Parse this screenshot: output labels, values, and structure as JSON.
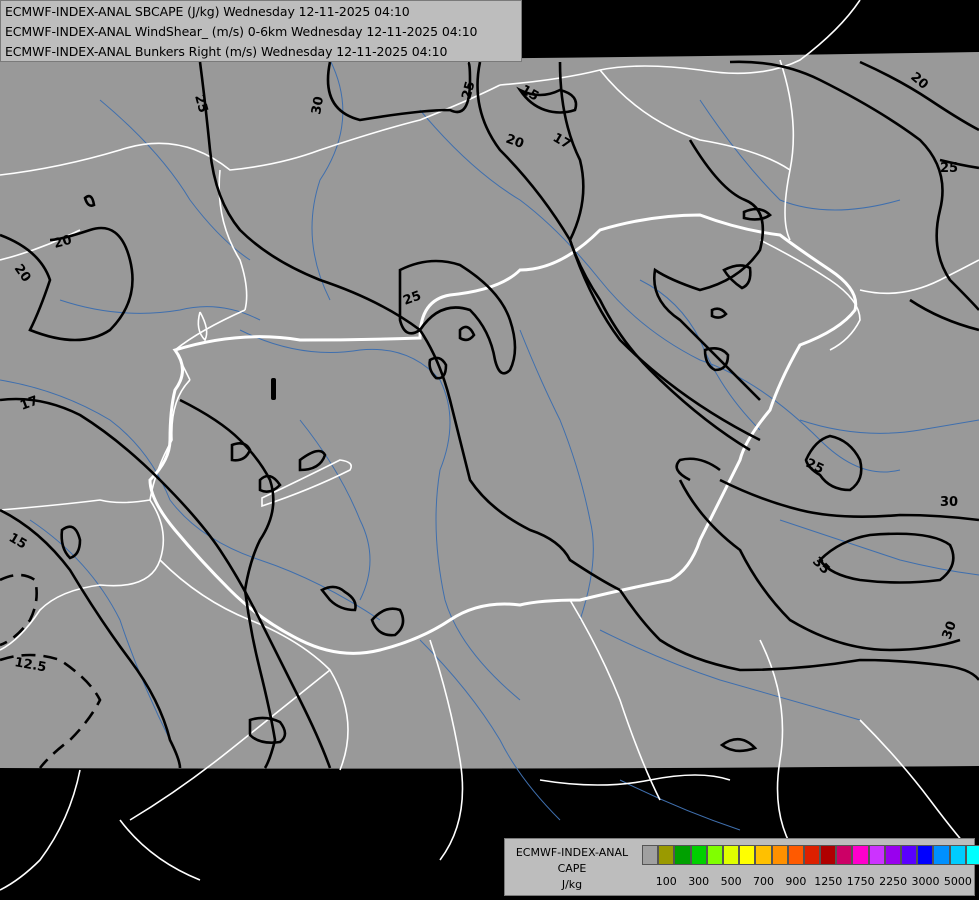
{
  "header": {
    "line1": "ECMWF-INDEX-ANAL SBCAPE (J/kg) Wednesday 12-11-2025 04:10",
    "line2": "ECMWF-INDEX-ANAL WindShear_ (m/s) 0-6km Wednesday 12-11-2025 04:10",
    "line3": "ECMWF-INDEX-ANAL Bunkers Right (m/s) Wednesday 12-11-2025 04:10"
  },
  "legend": {
    "title1": "ECMWF-INDEX-ANAL",
    "title2": "CAPE",
    "title3": "J/kg",
    "colors": [
      "#a0a0a0",
      "#9a9a00",
      "#00a000",
      "#00d000",
      "#80ff00",
      "#e0ff00",
      "#ffff00",
      "#ffc000",
      "#ff9000",
      "#ff5a00",
      "#dd2000",
      "#b00000",
      "#cc0066",
      "#ff00cc",
      "#cc33ff",
      "#9900ee",
      "#5a00ff",
      "#0000ff",
      "#0090ff",
      "#00ccff",
      "#00ffff",
      "#66ffff",
      "#ffffff"
    ],
    "ticks": [
      "100",
      "300",
      "500",
      "700",
      "900",
      "1250",
      "1750",
      "2250",
      "3000",
      "5000"
    ]
  },
  "map": {
    "background": "#000000",
    "domain_fill": "#999999",
    "border_color": "#ffffff",
    "river_color": "#3f6fae",
    "contour_color": "#000000",
    "contour_labels": [
      "25",
      "30",
      "25",
      "15",
      "17",
      "20",
      "20",
      "20",
      "25",
      "25",
      "17",
      "25",
      "30",
      "35",
      "30",
      "15",
      "12.5"
    ]
  }
}
